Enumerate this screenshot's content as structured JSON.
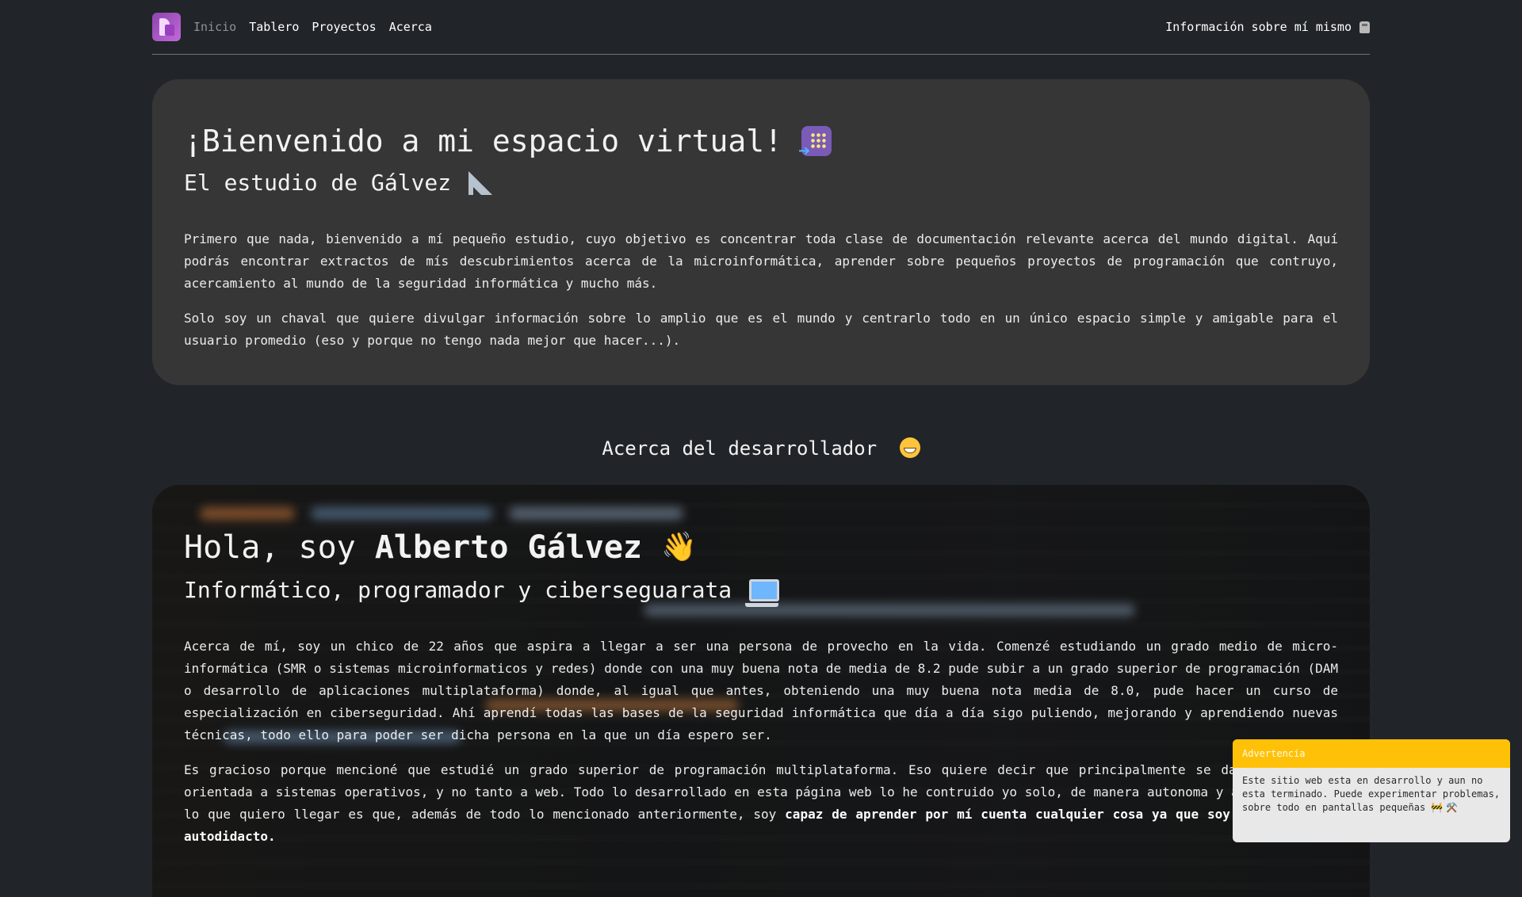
{
  "navbar": {
    "links": [
      {
        "label": "Inicio",
        "active": true
      },
      {
        "label": "Tablero",
        "active": false
      },
      {
        "label": "Proyectos",
        "active": false
      },
      {
        "label": "Acerca",
        "active": false
      }
    ],
    "right_label": "Información sobre mí mismo",
    "right_icon": "disk-icon"
  },
  "welcome": {
    "title": "¡Bienvenido a mi espacio virtual!",
    "title_icon": "app-grid-icon",
    "subtitle": "El estudio de Gálvez",
    "subtitle_icon": "triangular-ruler-icon",
    "paragraphs": [
      "Primero que nada, bienvenido a mí pequeño estudio, cuyo objetivo es concentrar toda clase de documentación relevante acerca del mundo digital. Aquí podrás encontrar extractos de mís descubrimientos acerca de la microinformática, aprender sobre pequeños proyectos de programación que contruyo, acercamiento al mundo de la seguridad informática y mucho más.",
      "Solo soy un chaval que quiere divulgar información sobre lo amplio que es el mundo y centrarlo todo en un único espacio simple y amigable para el usuario promedio (eso y porque no tengo nada mejor que hacer...)."
    ]
  },
  "about_section": {
    "title": "Acerca del desarrollador",
    "title_icon": "grinning-face-icon"
  },
  "about": {
    "greeting": "Hola, soy",
    "name": "Alberto Gálvez",
    "greeting_icon": "waving-hand-icon",
    "wave_glyph": "👋",
    "subtitle": "Informático, programador y ciberseguarata",
    "subtitle_icon": "laptop-icon",
    "paragraph1": "Acerca de mí, soy un chico de 22 años que aspira a llegar a ser una persona de provecho en la vida. Comenzé estudiando un grado medio de micro-informática (SMR o sistemas microinformaticos y redes) donde con una muy buena nota de media de 8.2 pude subir a un grado superior de programación (DAM o desarrollo de aplicaciones multiplataforma) donde, al igual que antes, obteniendo una muy buena nota media de 8.0, pude hacer un curso de especialización en ciberseguridad. Ahí aprendí todas las bases de la seguridad informática que día a día sigo puliendo, mejorando y aprendiendo nuevas técnicas, todo ello para poder ser dicha persona en la que un día espero ser.",
    "paragraph2_text": "Es gracioso porque mencioné que estudié un grado superior de programación multiplataforma. Eso quiere decir que principalmente se da programación orientada a sistemas operativos, y no tanto a web. Todo lo desarrollado en esta página web lo he contruido yo solo, de manera autonoma y autodidacta. A lo que quiero llegar es que, además de todo lo mencionado anteriormente, soy",
    "paragraph2_bold": "capaz de aprender por mí cuenta cualquier cosa ya que soy completamente autodidacto."
  },
  "warning_toast": {
    "title": "Advertencia",
    "message": "Este sitio web esta en desarrollo y aun no esta terminado. Puede experimentar problemas, sobre todo en pantallas pequeñas",
    "icons": "🚧 ⚒️",
    "accent_color": "#ffc107"
  },
  "colors": {
    "background": "#212529",
    "card": "#363636",
    "text": "#f2f2f2",
    "muted_nav": "#8c939a"
  }
}
